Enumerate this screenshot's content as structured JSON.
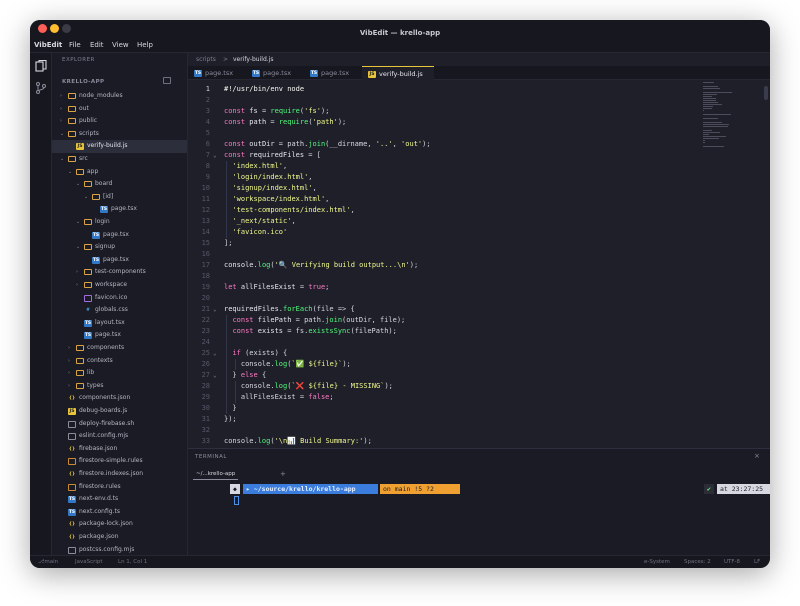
{
  "window": {
    "title": "VibEdit — krello-app"
  },
  "menubar": {
    "app": "VibEdit",
    "items": [
      "File",
      "Edit",
      "View",
      "Help"
    ]
  },
  "sidebar": {
    "header": "EXPLORER",
    "section": "KRELLO-APP",
    "tree": [
      {
        "label": "node_modules",
        "type": "folder",
        "depth": 0,
        "open": false
      },
      {
        "label": "out",
        "type": "folder",
        "depth": 0,
        "open": false
      },
      {
        "label": "public",
        "type": "folder",
        "depth": 0,
        "open": false
      },
      {
        "label": "scripts",
        "type": "folder",
        "depth": 0,
        "open": true
      },
      {
        "label": "verify-build.js",
        "type": "js",
        "depth": 1,
        "selected": true
      },
      {
        "label": "src",
        "type": "folder",
        "depth": 0,
        "open": true
      },
      {
        "label": "app",
        "type": "folder",
        "depth": 1,
        "open": true
      },
      {
        "label": "board",
        "type": "folder",
        "depth": 2,
        "open": true
      },
      {
        "label": "[id]",
        "type": "folder",
        "depth": 3,
        "open": true
      },
      {
        "label": "page.tsx",
        "type": "ts",
        "depth": 4
      },
      {
        "label": "login",
        "type": "folder",
        "depth": 2,
        "open": true
      },
      {
        "label": "page.tsx",
        "type": "ts",
        "depth": 3
      },
      {
        "label": "signup",
        "type": "folder",
        "depth": 2,
        "open": true
      },
      {
        "label": "page.tsx",
        "type": "ts",
        "depth": 3
      },
      {
        "label": "test-components",
        "type": "folder",
        "depth": 2,
        "open": false
      },
      {
        "label": "workspace",
        "type": "folder",
        "depth": 2,
        "open": false
      },
      {
        "label": "favicon.ico",
        "type": "ico",
        "depth": 2
      },
      {
        "label": "globals.css",
        "type": "css",
        "depth": 2
      },
      {
        "label": "layout.tsx",
        "type": "ts",
        "depth": 2
      },
      {
        "label": "page.tsx",
        "type": "ts",
        "depth": 2
      },
      {
        "label": "components",
        "type": "folder",
        "depth": 1,
        "open": false
      },
      {
        "label": "contexts",
        "type": "folder",
        "depth": 1,
        "open": false
      },
      {
        "label": "lib",
        "type": "folder",
        "depth": 1,
        "open": false
      },
      {
        "label": "types",
        "type": "folder",
        "depth": 1,
        "open": false
      },
      {
        "label": "components.json",
        "type": "json",
        "depth": 0
      },
      {
        "label": "debug-boards.js",
        "type": "js",
        "depth": 0
      },
      {
        "label": "deploy-firebase.sh",
        "type": "sh",
        "depth": 0
      },
      {
        "label": "eslint.config.mjs",
        "type": "sh",
        "depth": 0
      },
      {
        "label": "firebase.json",
        "type": "json",
        "depth": 0
      },
      {
        "label": "firestore-simple.rules",
        "type": "rules",
        "depth": 0
      },
      {
        "label": "firestore.indexes.json",
        "type": "json",
        "depth": 0
      },
      {
        "label": "firestore.rules",
        "type": "rules",
        "depth": 0
      },
      {
        "label": "next-env.d.ts",
        "type": "ts",
        "depth": 0
      },
      {
        "label": "next.config.ts",
        "type": "ts",
        "depth": 0
      },
      {
        "label": "package-lock.json",
        "type": "json",
        "depth": 0
      },
      {
        "label": "package.json",
        "type": "json",
        "depth": 0
      },
      {
        "label": "postcss.config.mjs",
        "type": "sh",
        "depth": 0
      }
    ]
  },
  "breadcrumb": [
    "scripts",
    ">",
    "verify-build.js"
  ],
  "tabs": [
    {
      "label": "page.tsx",
      "type": "ts",
      "active": false
    },
    {
      "label": "page.tsx",
      "type": "ts",
      "active": false
    },
    {
      "label": "page.tsx",
      "type": "ts",
      "active": false
    },
    {
      "label": "verify-build.js",
      "type": "js",
      "active": true
    }
  ],
  "editor": {
    "current_line": 1,
    "lines": [
      {
        "n": "1",
        "fold": "",
        "tokens": [
          [
            "cm",
            "#!/usr/bin/env node"
          ]
        ]
      },
      {
        "n": "2",
        "fold": "",
        "tokens": []
      },
      {
        "n": "3",
        "fold": "",
        "tokens": [
          [
            "kw",
            "const "
          ],
          [
            "ident",
            "fs"
          ],
          [
            "pn",
            " = "
          ],
          [
            "fn",
            "require"
          ],
          [
            "pn",
            "("
          ],
          [
            "str",
            "'fs'"
          ],
          [
            "pn",
            ");"
          ]
        ]
      },
      {
        "n": "4",
        "fold": "",
        "tokens": [
          [
            "kw",
            "const "
          ],
          [
            "ident",
            "path"
          ],
          [
            "pn",
            " = "
          ],
          [
            "fn",
            "require"
          ],
          [
            "pn",
            "("
          ],
          [
            "str",
            "'path'"
          ],
          [
            "pn",
            ");"
          ]
        ]
      },
      {
        "n": "5",
        "fold": "",
        "tokens": []
      },
      {
        "n": "6",
        "fold": "",
        "tokens": [
          [
            "kw",
            "const "
          ],
          [
            "ident",
            "outDir"
          ],
          [
            "pn",
            " = path."
          ],
          [
            "fn",
            "join"
          ],
          [
            "pn",
            "(__dirname, "
          ],
          [
            "str",
            "'..'"
          ],
          [
            "pn",
            ", "
          ],
          [
            "str",
            "'out'"
          ],
          [
            "pn",
            ");"
          ]
        ]
      },
      {
        "n": "7",
        "fold": "v",
        "tokens": [
          [
            "kw",
            "const "
          ],
          [
            "ident",
            "requiredFiles"
          ],
          [
            "pn",
            " = ["
          ]
        ]
      },
      {
        "n": "8",
        "fold": "",
        "tokens": [
          [
            "pn",
            "  "
          ],
          [
            "str",
            "'index.html'"
          ],
          [
            "pn",
            ","
          ]
        ]
      },
      {
        "n": "9",
        "fold": "",
        "tokens": [
          [
            "pn",
            "  "
          ],
          [
            "str",
            "'login/index.html'"
          ],
          [
            "pn",
            ","
          ]
        ]
      },
      {
        "n": "10",
        "fold": "",
        "tokens": [
          [
            "pn",
            "  "
          ],
          [
            "str",
            "'signup/index.html'"
          ],
          [
            "pn",
            ","
          ]
        ]
      },
      {
        "n": "11",
        "fold": "",
        "tokens": [
          [
            "pn",
            "  "
          ],
          [
            "str",
            "'workspace/index.html'"
          ],
          [
            "pn",
            ","
          ]
        ]
      },
      {
        "n": "12",
        "fold": "",
        "tokens": [
          [
            "pn",
            "  "
          ],
          [
            "str",
            "'test-components/index.html'"
          ],
          [
            "pn",
            ","
          ]
        ]
      },
      {
        "n": "13",
        "fold": "",
        "tokens": [
          [
            "pn",
            "  "
          ],
          [
            "str",
            "'_next/static'"
          ],
          [
            "pn",
            ","
          ]
        ]
      },
      {
        "n": "14",
        "fold": "",
        "tokens": [
          [
            "pn",
            "  "
          ],
          [
            "str",
            "'favicon.ico'"
          ]
        ]
      },
      {
        "n": "15",
        "fold": "",
        "tokens": [
          [
            "pn",
            "];"
          ]
        ]
      },
      {
        "n": "16",
        "fold": "",
        "tokens": []
      },
      {
        "n": "17",
        "fold": "",
        "tokens": [
          [
            "ident",
            "console"
          ],
          [
            "pn",
            "."
          ],
          [
            "fn",
            "log"
          ],
          [
            "pn",
            "("
          ],
          [
            "str",
            "'🔍 Verifying build output...\\n'"
          ],
          [
            "pn",
            ");"
          ]
        ]
      },
      {
        "n": "18",
        "fold": "",
        "tokens": []
      },
      {
        "n": "19",
        "fold": "",
        "tokens": [
          [
            "kw",
            "let "
          ],
          [
            "ident",
            "allFilesExist"
          ],
          [
            "pn",
            " = "
          ],
          [
            "kw",
            "true"
          ],
          [
            "pn",
            ";"
          ]
        ]
      },
      {
        "n": "20",
        "fold": "",
        "tokens": []
      },
      {
        "n": "21",
        "fold": "v",
        "tokens": [
          [
            "ident",
            "requiredFiles"
          ],
          [
            "pn",
            "."
          ],
          [
            "fn",
            "forEach"
          ],
          [
            "pn",
            "(file => {"
          ]
        ]
      },
      {
        "n": "22",
        "fold": "",
        "tokens": [
          [
            "pn",
            "  "
          ],
          [
            "kw",
            "const "
          ],
          [
            "ident",
            "filePath"
          ],
          [
            "pn",
            " = path."
          ],
          [
            "fn",
            "join"
          ],
          [
            "pn",
            "(outDir, file);"
          ]
        ]
      },
      {
        "n": "23",
        "fold": "",
        "tokens": [
          [
            "pn",
            "  "
          ],
          [
            "kw",
            "const "
          ],
          [
            "ident",
            "exists"
          ],
          [
            "pn",
            " = fs."
          ],
          [
            "fn",
            "existsSync"
          ],
          [
            "pn",
            "(filePath);"
          ]
        ]
      },
      {
        "n": "24",
        "fold": "",
        "tokens": []
      },
      {
        "n": "25",
        "fold": "v",
        "tokens": [
          [
            "pn",
            "  "
          ],
          [
            "kw",
            "if "
          ],
          [
            "pn",
            "(exists) {"
          ]
        ]
      },
      {
        "n": "26",
        "fold": "",
        "tokens": [
          [
            "pn",
            "    console."
          ],
          [
            "fn",
            "log"
          ],
          [
            "pn",
            "("
          ],
          [
            "str",
            "`✅ ${file}`"
          ],
          [
            "pn",
            ");"
          ]
        ]
      },
      {
        "n": "27",
        "fold": "v",
        "tokens": [
          [
            "pn",
            "  } "
          ],
          [
            "kw",
            "else "
          ],
          [
            "pn",
            "{"
          ]
        ]
      },
      {
        "n": "28",
        "fold": "",
        "tokens": [
          [
            "pn",
            "    console."
          ],
          [
            "fn",
            "log"
          ],
          [
            "pn",
            "("
          ],
          [
            "str",
            "`❌ ${file} - MISSING`"
          ],
          [
            "pn",
            ");"
          ]
        ]
      },
      {
        "n": "29",
        "fold": "",
        "tokens": [
          [
            "pn",
            "    allFilesExist = "
          ],
          [
            "kw",
            "false"
          ],
          [
            "pn",
            ";"
          ]
        ]
      },
      {
        "n": "30",
        "fold": "",
        "tokens": [
          [
            "pn",
            "  }"
          ]
        ]
      },
      {
        "n": "31",
        "fold": "",
        "tokens": [
          [
            "pn",
            "});"
          ]
        ]
      },
      {
        "n": "32",
        "fold": "",
        "tokens": []
      },
      {
        "n": "33",
        "fold": "",
        "tokens": [
          [
            "pn",
            "console."
          ],
          [
            "fn",
            "log"
          ],
          [
            "pn",
            "("
          ],
          [
            "str",
            "'\\n📊 Build Summary:'"
          ],
          [
            "pn",
            ");"
          ]
        ]
      }
    ]
  },
  "terminal": {
    "title": "TERMINAL",
    "close": "×",
    "tab": "~/...krello-app",
    "add": "+",
    "prompt_path": "~/source/krello/krello-app",
    "prompt_git": "on  main !5 ?2",
    "prompt_right_status": "✔",
    "prompt_time": "at 23:27:25"
  },
  "statusbar": {
    "branch": "main",
    "language": "JavaScript",
    "position": "Ln 1, Col 1",
    "theme": "e-System",
    "indent": "Spaces: 2",
    "encoding": "UTF-8",
    "eol": "LF"
  },
  "colors": {
    "keyword": "#ff79c6",
    "string": "#f1fa8c",
    "function": "#50fa7b",
    "accent": "#e8c43a",
    "prompt_blue": "#3b7ddd",
    "prompt_orange": "#f0a030"
  }
}
